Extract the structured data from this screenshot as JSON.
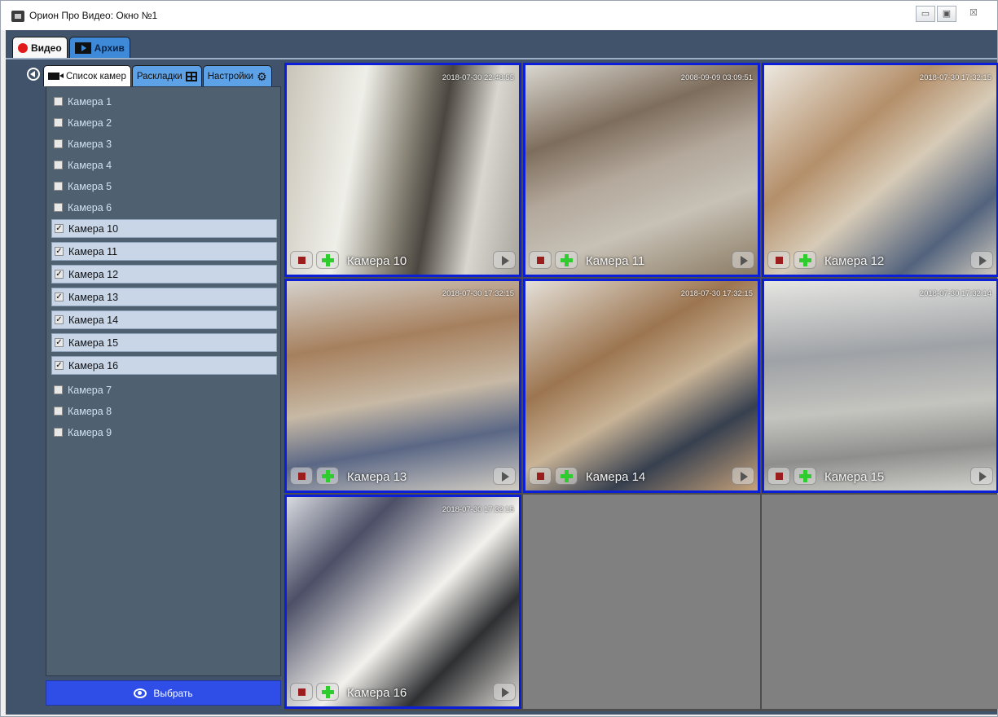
{
  "window": {
    "title": "Орион Про Видео: Окно №1",
    "minimize": "▭",
    "maximize": "▣",
    "close": "☒"
  },
  "main_tabs": [
    {
      "label": "Видео",
      "icon": "record-dot-icon",
      "active": true
    },
    {
      "label": "Архив",
      "icon": "film-icon",
      "active": false
    }
  ],
  "panel_tabs": [
    {
      "label": "Список камер",
      "icon": "camera-icon",
      "active": true
    },
    {
      "label": "Раскладки",
      "icon": "layout-grid-icon",
      "active": false
    },
    {
      "label": "Настройки",
      "icon": "gear-icon",
      "active": false
    }
  ],
  "cameras": [
    {
      "label": "Камера 1",
      "checked": false
    },
    {
      "label": "Камера 2",
      "checked": false
    },
    {
      "label": "Камера 3",
      "checked": false
    },
    {
      "label": "Камера 4",
      "checked": false
    },
    {
      "label": "Камера 5",
      "checked": false
    },
    {
      "label": "Камера 6",
      "checked": false
    },
    {
      "label": "Камера 10",
      "checked": true
    },
    {
      "label": "Камера 11",
      "checked": true
    },
    {
      "label": "Камера 12",
      "checked": true
    },
    {
      "label": "Камера 13",
      "checked": true
    },
    {
      "label": "Камера 14",
      "checked": true
    },
    {
      "label": "Камера 15",
      "checked": true
    },
    {
      "label": "Камера 16",
      "checked": true
    },
    {
      "label": "Камера 7",
      "checked": false
    },
    {
      "label": "Камера 8",
      "checked": false
    },
    {
      "label": "Камера 9",
      "checked": false
    }
  ],
  "select_button": {
    "label": "Выбрать",
    "icon": "eye-icon"
  },
  "video_cells": [
    {
      "camera": "Камера 10",
      "timestamp": "2018-07-30 22:48:55",
      "live": true
    },
    {
      "camera": "Камера 11",
      "timestamp": "2008-09-09 03:09:51",
      "live": true
    },
    {
      "camera": "Камера 12",
      "timestamp": "2018-07-30 17:32:15",
      "live": true
    },
    {
      "camera": "Камера 13",
      "timestamp": "2018-07-30 17:32:15",
      "live": true
    },
    {
      "camera": "Камера 14",
      "timestamp": "2018-07-30 17:32:15",
      "live": true
    },
    {
      "camera": "Камера 15",
      "timestamp": "2018-07-30 17:32:14",
      "live": true
    },
    {
      "camera": "Камера 16",
      "timestamp": "2018-07-30 17:32:15",
      "live": true
    },
    {
      "camera": "",
      "timestamp": "",
      "live": false
    },
    {
      "camera": "",
      "timestamp": "",
      "live": false
    }
  ],
  "colors": {
    "app_background": "#41536a",
    "list_background": "#4f6071",
    "selected_row": "#c8d6e7",
    "select_button": "#2f4ee8",
    "live_border": "#0b1fd8",
    "empty_cell": "#808080"
  }
}
